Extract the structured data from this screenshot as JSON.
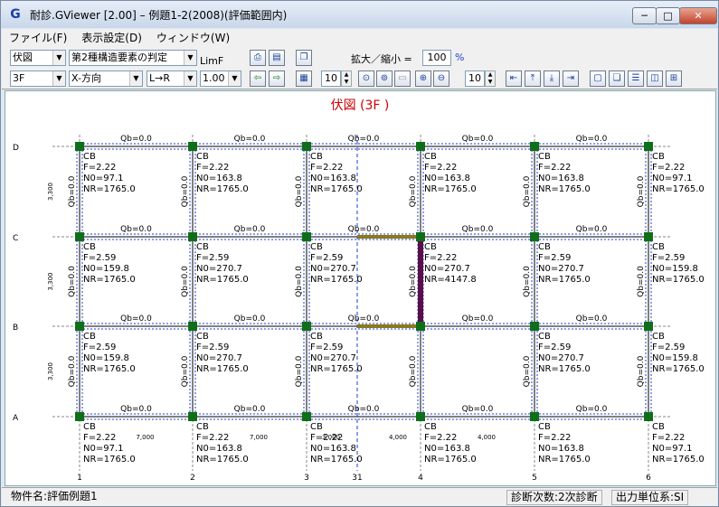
{
  "window": {
    "app_icon": "G",
    "title": "耐診.GViewer [2.00] – 例題1-2(2008)(評価範囲内)",
    "min": "─",
    "max": "□",
    "close": "✕"
  },
  "menu": [
    "ファイル(F)",
    "表示設定(D)",
    "ウィンドウ(W)"
  ],
  "toolbar": {
    "view_select": "伏図",
    "judge_select": "第2種構造要素の判定",
    "limf_label": "LimF",
    "floor_select": "3F",
    "dir_select": "X-方向",
    "order_select": "L→R",
    "scale_select": "1.00",
    "zoom_label": "拡大／縮小 =",
    "zoom_value": "100",
    "zoom_unit": "%",
    "step1": "10",
    "step2": "10"
  },
  "plan": {
    "title": "伏図 (3F )",
    "axis_x": [
      "1",
      "2",
      "3",
      "31",
      "4",
      "5",
      "6"
    ],
    "axis_y": [
      "D",
      "C",
      "B",
      "A"
    ],
    "spans_x": [
      "7,000",
      "7,000",
      "4,000",
      "4,000"
    ],
    "spans_x_extra": "3,000",
    "spans_y": [
      "3,300",
      "3,300",
      "3,300"
    ],
    "beam_label": "Qb=0.0",
    "rows": [
      {
        "cells": [
          {
            "t": "CB",
            "f": "F=2.22",
            "n0": "N0=97.1",
            "nr": "NR=1765.0"
          },
          {
            "t": "CB",
            "f": "F=2.22",
            "n0": "N0=163.8",
            "nr": "NR=1765.0"
          },
          {
            "t": "CB",
            "f": "F=2.22",
            "n0": "N0=163.8",
            "nr": "NR=1765.0"
          },
          {
            "t": "CB",
            "f": "F=2.22",
            "n0": "N0=163.8",
            "nr": "NR=1765.0"
          },
          {
            "t": "CB",
            "f": "F=2.22",
            "n0": "N0=163.8",
            "nr": "NR=1765.0"
          },
          {
            "t": "CB",
            "f": "F=2.22",
            "n0": "N0=97.1",
            "nr": "NR=1765.0"
          }
        ]
      },
      {
        "cells": [
          {
            "t": "CB",
            "f": "F=2.59",
            "n0": "N0=159.8",
            "nr": "NR=1765.0"
          },
          {
            "t": "CB",
            "f": "F=2.59",
            "n0": "N0=270.7",
            "nr": "NR=1765.0"
          },
          {
            "t": "CB",
            "f": "F=2.59",
            "n0": "N0=270.7",
            "nr": "NR=1765.0"
          },
          {
            "t": "CB",
            "f": "F=2.22",
            "n0": "N0=270.7",
            "nr": "NR=4147.8"
          },
          {
            "t": "CB",
            "f": "F=2.59",
            "n0": "N0=270.7",
            "nr": "NR=1765.0"
          },
          {
            "t": "CB",
            "f": "F=2.59",
            "n0": "N0=159.8",
            "nr": "NR=1765.0"
          }
        ]
      },
      {
        "cells": [
          {
            "t": "CB",
            "f": "F=2.59",
            "n0": "N0=159.8",
            "nr": "NR=1765.0"
          },
          {
            "t": "CB",
            "f": "F=2.59",
            "n0": "N0=270.7",
            "nr": "NR=1765.0"
          },
          {
            "t": "CB",
            "f": "F=2.59",
            "n0": "N0=270.7",
            "nr": "NR=1765.0"
          },
          null,
          {
            "t": "CB",
            "f": "F=2.59",
            "n0": "N0=270.7",
            "nr": "NR=1765.0"
          },
          {
            "t": "CB",
            "f": "F=2.59",
            "n0": "N0=159.8",
            "nr": "NR=1765.0"
          }
        ]
      },
      {
        "cells": [
          {
            "t": "CB",
            "f": "F=2.22",
            "n0": "N0=97.1",
            "nr": "NR=1765.0"
          },
          {
            "t": "CB",
            "f": "F=2.22",
            "n0": "N0=163.8",
            "nr": "NR=1765.0"
          },
          {
            "t": "CB",
            "f": "F=2.22",
            "n0": "N0=163.8",
            "nr": "NR=1765.0"
          },
          {
            "t": "CB",
            "f": "F=2.22",
            "n0": "N0=163.8",
            "nr": "NR=1765.0"
          },
          {
            "t": "CB",
            "f": "F=2.22",
            "n0": "N0=163.8",
            "nr": "NR=1765.0"
          },
          {
            "t": "CB",
            "f": "F=2.22",
            "n0": "N0=97.1",
            "nr": "NR=1765.0"
          }
        ]
      }
    ]
  },
  "status": {
    "project": "物件名:評価例題1",
    "diag": "診断次数:2次診断",
    "unit": "出力単位系:SI"
  },
  "colors": {
    "title_red": "#cc0000",
    "column_green": "#0f6e1a",
    "wall_purple": "#5a0f4a",
    "grid_blue": "#1f3fcc"
  }
}
